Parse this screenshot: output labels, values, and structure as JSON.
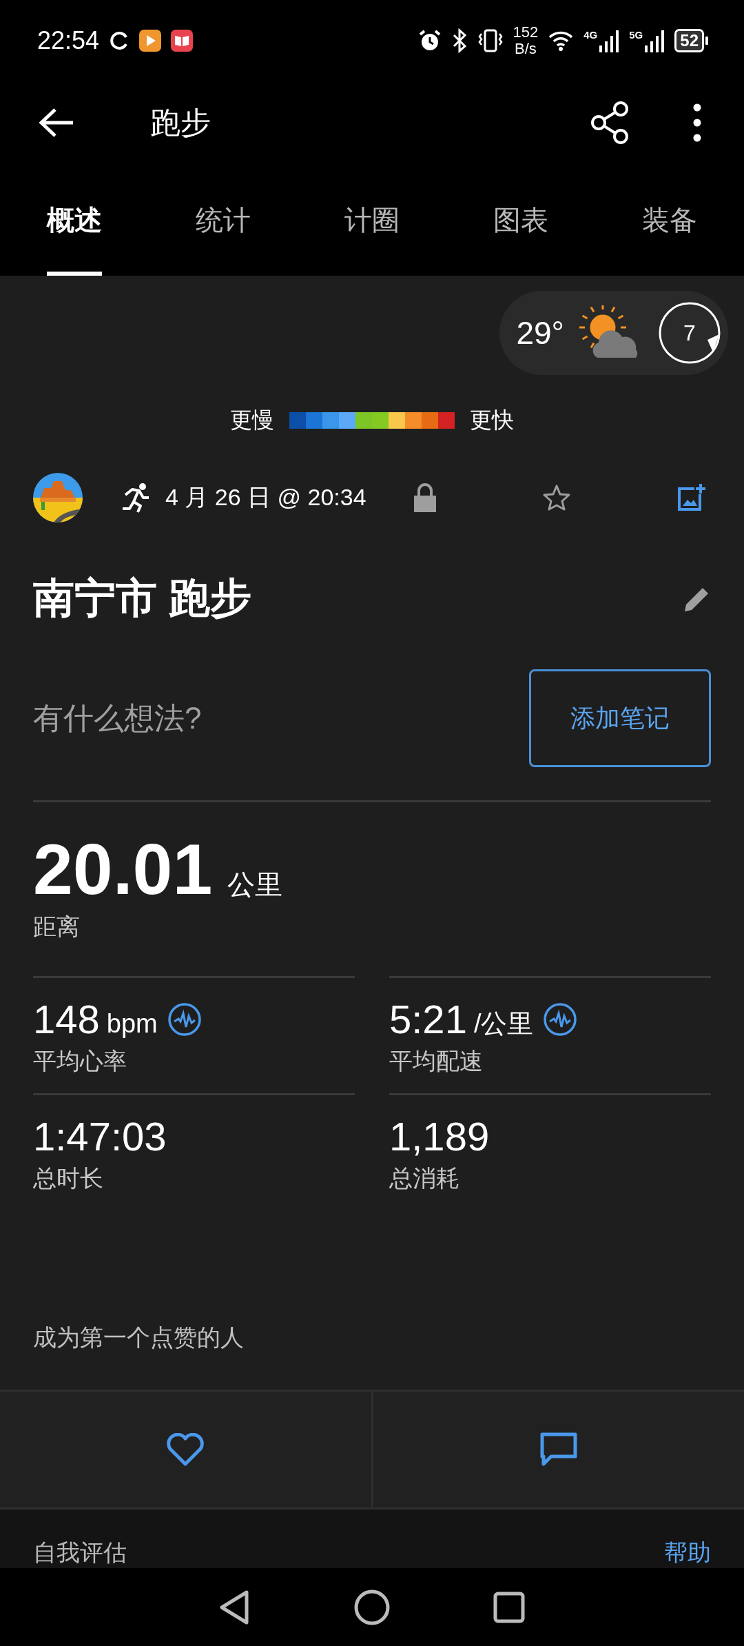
{
  "status_bar": {
    "time": "22:54",
    "net_speed_value": "152",
    "net_speed_unit": "B/s",
    "network_1": "4G",
    "network_2": "5G",
    "battery": "52"
  },
  "header": {
    "title": "跑步"
  },
  "tabs": [
    {
      "label": "概述",
      "selected": true
    },
    {
      "label": "统计",
      "selected": false
    },
    {
      "label": "计圈",
      "selected": false
    },
    {
      "label": "图表",
      "selected": false
    },
    {
      "label": "装备",
      "selected": false
    }
  ],
  "weather": {
    "temperature": "29°",
    "wind": "7"
  },
  "pace_legend": {
    "slow_label": "更慢",
    "fast_label": "更快"
  },
  "activity": {
    "date": "4 月 26 日 @ 20:34",
    "title": "南宁市 跑步"
  },
  "note": {
    "placeholder": "有什么想法?",
    "button": "添加笔记"
  },
  "distance": {
    "value": "20.01",
    "unit": "公里",
    "label": "距离"
  },
  "metrics": [
    {
      "value": "148",
      "unit": "bpm",
      "label": "平均心率",
      "trend_icon": true
    },
    {
      "value": "5:21",
      "unit": "/公里",
      "label": "平均配速",
      "trend_icon": true
    },
    {
      "value": "1:47:03",
      "label": "总时长",
      "trend_icon": false
    },
    {
      "value": "1,189",
      "label": "总消耗",
      "trend_icon": false
    }
  ],
  "likes_text": "成为第一个点赞的人",
  "self_evaluation": {
    "title": "自我评估",
    "help_link": "帮助"
  }
}
